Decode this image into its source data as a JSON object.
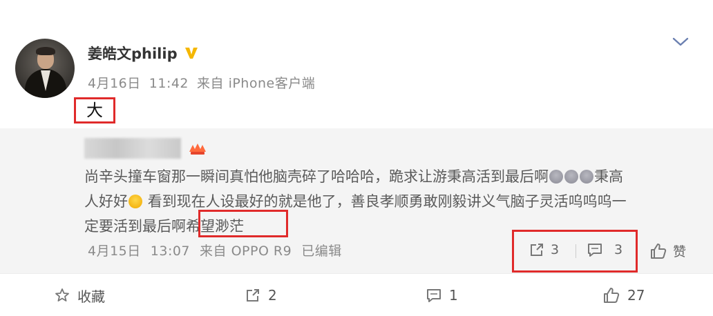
{
  "author": {
    "name": "姜皓文philip",
    "verified_icon": "vip-v-badge-icon"
  },
  "post": {
    "date": "4月16日",
    "time": "11:42",
    "source": "来自 iPhone客户端",
    "text": "大"
  },
  "quoted_comment": {
    "line1": "尚辛头撞车窗那一瞬间真怕他脑壳碎了哈哈哈，跪求让游秉高活到最后啊",
    "line1_tail": "秉高",
    "line2_head": "人好好",
    "line2_tail": "看到现在人设最好的就是他了，善良孝顺勇敢刚毅讲义气脑子灵活呜呜呜一",
    "line3_head": "定要活到最后啊",
    "line3_tail": "希望渺茫",
    "date": "4月15日",
    "time": "13:07",
    "source": "来自 OPPO R9",
    "edited": "已编辑",
    "repost_count": "3",
    "comment_count": "3",
    "like_label": "赞"
  },
  "toolbar": {
    "favorite_label": "收藏",
    "repost_count": "2",
    "comment_count": "1",
    "like_count": "27"
  },
  "colors": {
    "highlight": "#e02a2a",
    "verified": "#f5b700"
  }
}
